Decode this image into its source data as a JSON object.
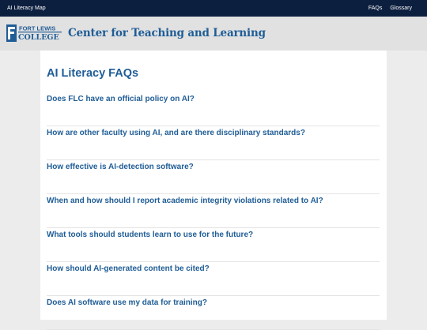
{
  "topbar": {
    "brand": "AI Literacy Map",
    "links": [
      "FAQs",
      "Glossary"
    ]
  },
  "header": {
    "logo_line1": "FORT LEWIS",
    "logo_line2": "COLLEGE",
    "title": "Center for Teaching and Learning"
  },
  "main": {
    "title": "AI Literacy FAQs",
    "faqs": [
      "Does FLC have an official policy on AI?",
      "How are other faculty using AI, and are there disciplinary standards?",
      "How effective is AI-detection software?",
      "When and how should I report academic integrity violations related to AI?",
      "What tools should students learn to use for the future?",
      "How should AI-generated content be cited?",
      "Does AI software use my data for training?"
    ]
  },
  "colors": {
    "topbar_bg": "#0d1f3f",
    "header_bg": "#e1e1e1",
    "accent_blue": "#1f5d96",
    "page_bg": "#ececec"
  }
}
